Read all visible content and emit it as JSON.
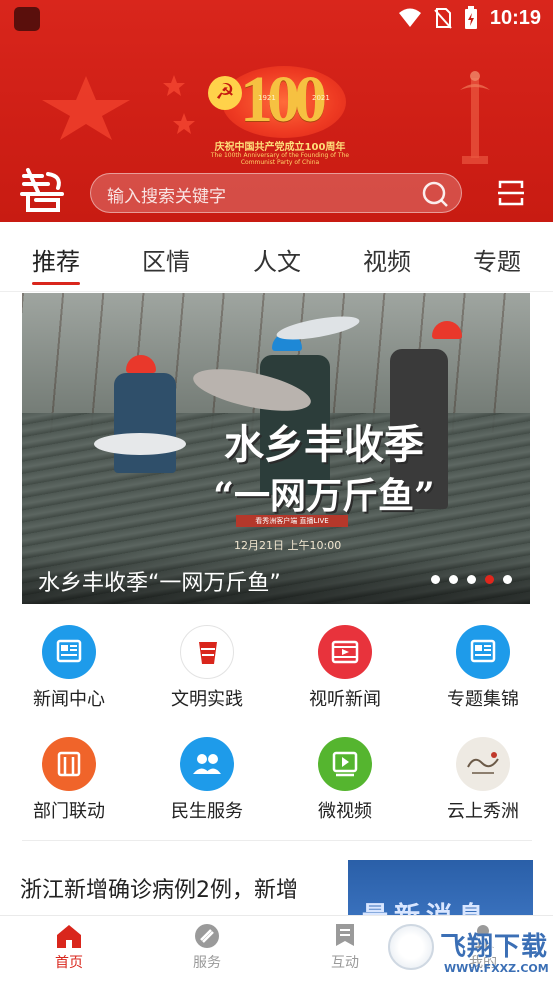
{
  "status_bar": {
    "time": "10:19"
  },
  "header": {
    "emblem_years_left": "1921",
    "emblem_years_right": "2021",
    "emblem_number": "100",
    "emblem_caption": "庆祝中国共产党成立100周年",
    "emblem_caption_en": "The 100th Anniversary of the Founding of The Communist Party of China"
  },
  "search": {
    "placeholder": "输入搜索关键字"
  },
  "tabs": [
    {
      "label": "推荐",
      "active": true
    },
    {
      "label": "区情",
      "active": false
    },
    {
      "label": "人文",
      "active": false
    },
    {
      "label": "视频",
      "active": false
    },
    {
      "label": "专题",
      "active": false
    }
  ],
  "banner": {
    "headline_line1": "水乡丰收季",
    "headline_line2": "“一网万斤鱼”",
    "tag": "看秀洲客户端 直播LIVE",
    "time": "12月21日 上午10:00",
    "caption": "水乡丰收季“一网万斤鱼”",
    "slide_count": 5,
    "active_slide": 4
  },
  "grid": [
    {
      "label": "新闻中心",
      "icon": "newspaper-icon",
      "color": "#1e9bea"
    },
    {
      "label": "文明实践",
      "icon": "civilization-emblem-icon",
      "color": "#d9261c"
    },
    {
      "label": "视听新闻",
      "icon": "film-icon",
      "color": "#e8333c"
    },
    {
      "label": "专题集锦",
      "icon": "collection-icon",
      "color": "#1e9bea"
    },
    {
      "label": "部门联动",
      "icon": "department-icon",
      "color": "#f0642a"
    },
    {
      "label": "民生服务",
      "icon": "people-icon",
      "color": "#1e9bea"
    },
    {
      "label": "微视频",
      "icon": "video-icon",
      "color": "#55b52f"
    },
    {
      "label": "云上秀洲",
      "icon": "xiuzhou-map-icon",
      "color": "#8a6a4a"
    }
  ],
  "news": {
    "title": "浙江新增确诊病例2例，新增",
    "thumb_text": "最新消息"
  },
  "bottom_nav": [
    {
      "label": "首页",
      "icon": "home-icon",
      "active": true
    },
    {
      "label": "服务",
      "icon": "service-icon",
      "active": false
    },
    {
      "label": "互动",
      "icon": "interact-icon",
      "active": false
    },
    {
      "label": "我的",
      "icon": "profile-icon",
      "active": false
    }
  ],
  "watermark": {
    "text": "飞翔下载",
    "url": "WWW.FXXZ.COM"
  },
  "colors": {
    "brand_red": "#d9261c",
    "accent_blue": "#1e9bea",
    "inactive_gray": "#9a9a9a"
  }
}
